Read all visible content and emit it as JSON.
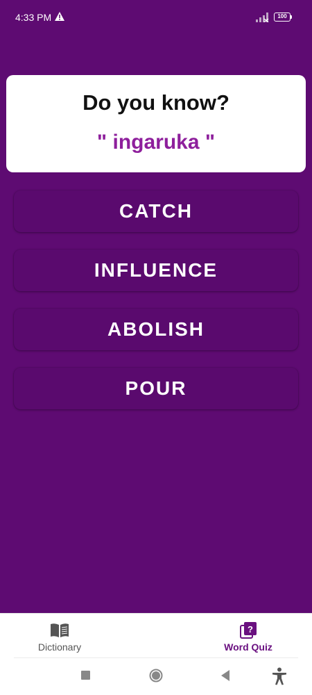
{
  "status_bar": {
    "time": "4:33 PM",
    "battery": "100",
    "icons": [
      "alert-icon",
      "signal-icon",
      "battery-icon"
    ]
  },
  "quiz": {
    "prompt": "Do you know?",
    "word": "\" ingaruka \"",
    "options": [
      "CATCH",
      "INFLUENCE",
      "ABOLISH",
      "POUR"
    ]
  },
  "bottom_nav": {
    "items": [
      {
        "label": "Dictionary",
        "icon": "book-icon",
        "active": false
      },
      {
        "label": "Word Quiz",
        "icon": "quiz-icon",
        "active": true
      }
    ]
  },
  "system_nav": {
    "buttons": [
      "recents-button",
      "home-button",
      "back-button",
      "accessibility-button"
    ]
  },
  "colors": {
    "background": "#5e0b72",
    "option_background": "#5a0a6e",
    "word_color": "#8e1f9c",
    "active_nav": "#6a1080"
  }
}
